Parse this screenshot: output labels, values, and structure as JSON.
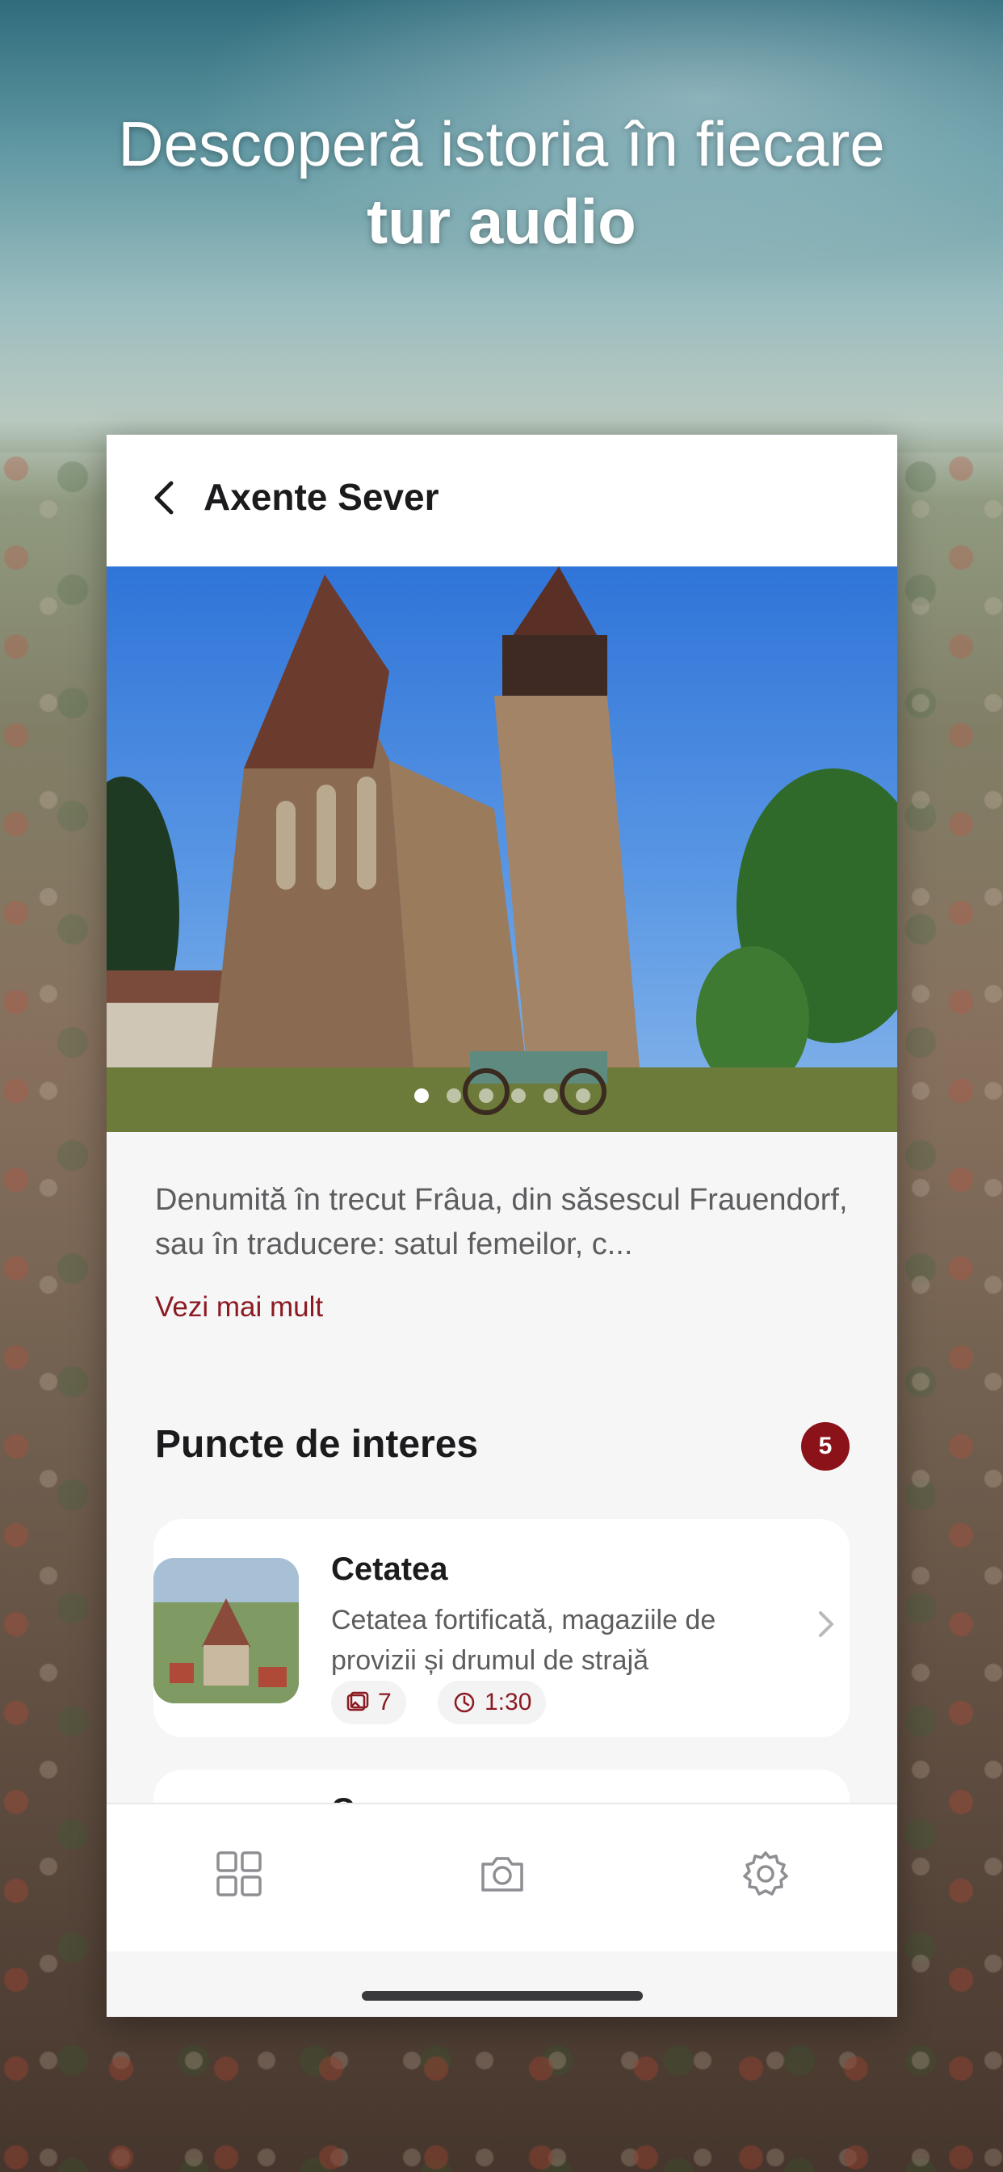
{
  "promo": {
    "headline_line1": "Descoperă istoria în fiecare",
    "headline_line2": "tur audio"
  },
  "screen": {
    "nav": {
      "back_icon": "chevron-left-icon",
      "title": "Axente Sever"
    },
    "gallery": {
      "image_count": 6,
      "active_index": 0
    },
    "description": "Denumită în trecut Frâua, din săsescul Frauendorf, sau în traducere: satul femeilor, c...",
    "read_more": "Vezi mai mult",
    "points_section": {
      "title": "Puncte de interes",
      "count": "5"
    },
    "points": [
      {
        "title": "Cetatea",
        "subtitle": "Cetatea fortificată, magaziile de provizii și drumul de strajă",
        "photos": "7",
        "duration": "1:30"
      },
      {
        "title": "C"
      }
    ],
    "tabbar": {
      "items": [
        "grid-icon",
        "camera-icon",
        "gear-icon"
      ]
    },
    "colors": {
      "accent": "#8b1219",
      "text": "#1b1b1d",
      "secondary_text": "#5d5d60"
    }
  }
}
